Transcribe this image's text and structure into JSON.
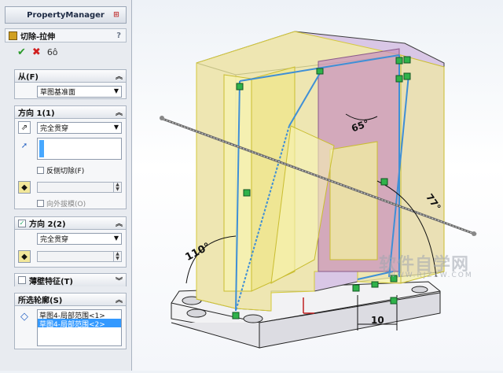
{
  "panel": {
    "title": "PropertyManager",
    "feature_name": "切除-拉伸",
    "help": "?",
    "actions": {
      "ok": "✔",
      "cancel": "✖",
      "preview": "6ô"
    }
  },
  "from": {
    "title": "从(F)",
    "value": "草图基准面"
  },
  "direction1": {
    "title": "方向 1(1)",
    "end_condition": "完全贯穿",
    "flip_side_label": "反侧切除(F)",
    "draft_outward_label": "向外拔模(O)"
  },
  "direction2": {
    "title": "方向 2(2)",
    "checked": true,
    "end_condition": "完全贯穿"
  },
  "thin_feature": {
    "title": "薄壁特征(T)"
  },
  "selected_contours": {
    "title": "所选轮廓(S)",
    "items": [
      "草图4-局部范围<1>",
      "草图4-局部范围<2>"
    ],
    "selected_index": 1
  },
  "viewport": {
    "dimensions": [
      "110°",
      "65°",
      "77°",
      "10"
    ],
    "watermark": "软件自学网",
    "watermark_url": "WWW.RJZXW.COM"
  },
  "colors": {
    "preview_fill": "#f4f0a0",
    "cut_region": "#c88fbf",
    "sketch_line": "#3f8fd6",
    "selection_handle": "#2fb24a"
  }
}
